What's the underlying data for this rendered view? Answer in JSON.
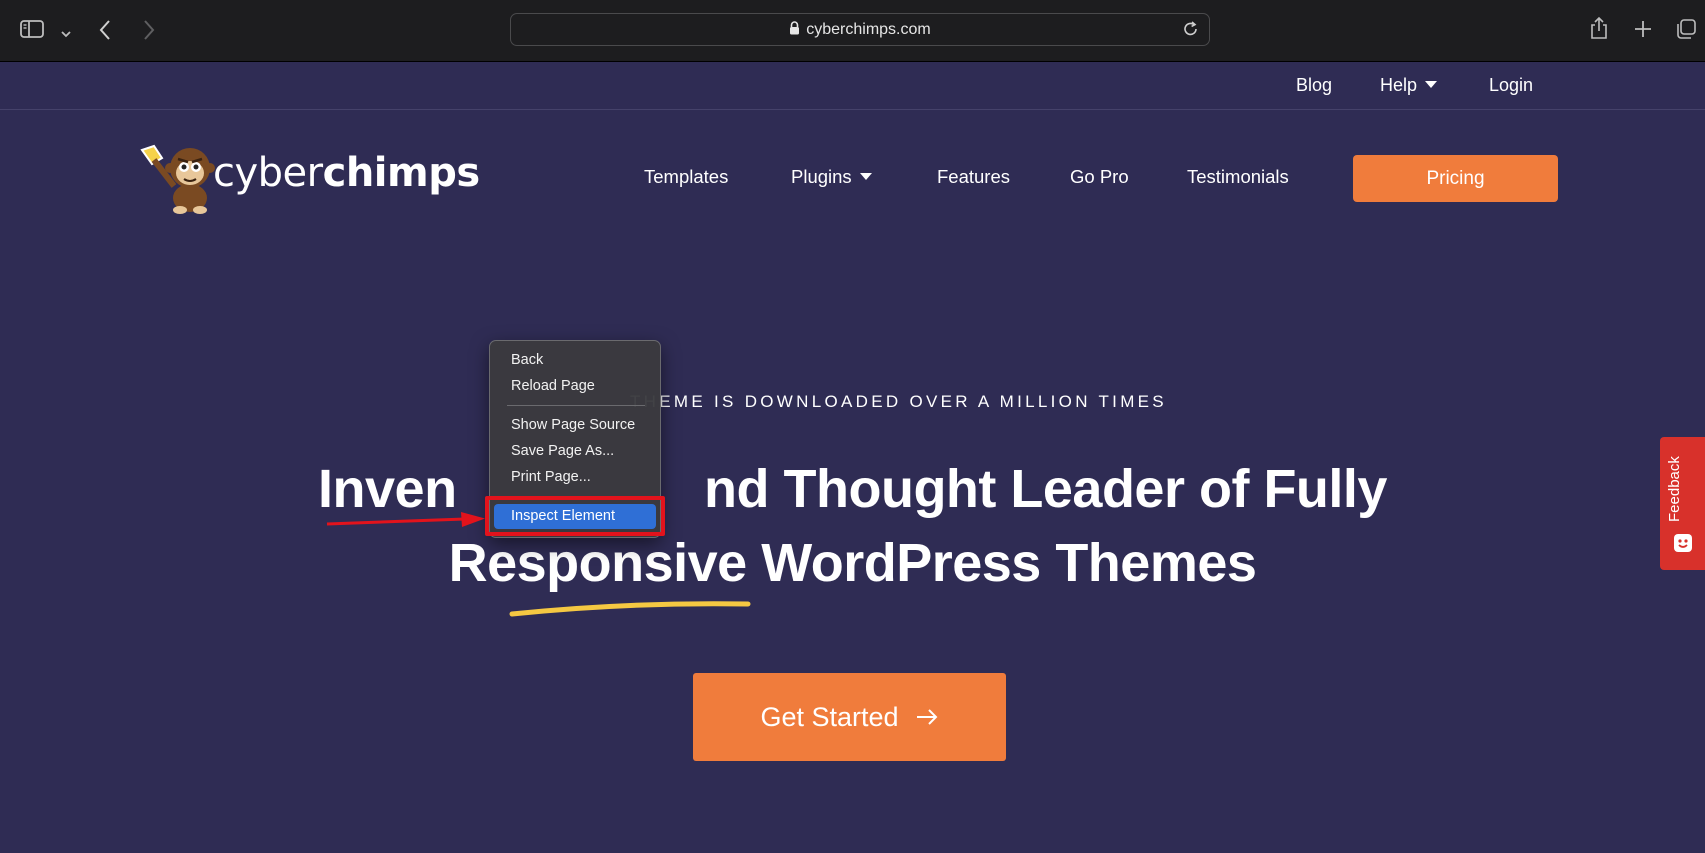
{
  "browser": {
    "url": "cyberchimps.com",
    "icons": [
      "sidebar-icon",
      "chevron-down-icon",
      "back-arrow-icon",
      "forward-arrow-icon",
      "lock-icon",
      "reload-icon",
      "share-icon",
      "new-tab-icon",
      "tabs-overview-icon"
    ]
  },
  "topnav": {
    "blog": "Blog",
    "help": "Help",
    "login": "Login"
  },
  "header": {
    "logo_text_regular": "cyber",
    "logo_text_bold": "chimps",
    "nav": {
      "templates": "Templates",
      "plugins": "Plugins",
      "features": "Features",
      "go_pro": "Go Pro",
      "testimonials": "Testimonials"
    },
    "pricing": "Pricing"
  },
  "hero": {
    "tagline": "THEME IS DOWNLOADED OVER A MILLION TIMES",
    "headline_line1": "Inven                        nd Thought Leader of Fully",
    "headline_line2": "Responsive WordPress Themes",
    "cta": "Get Started"
  },
  "context_menu": {
    "items": [
      "Back",
      "Reload Page",
      "Show Page Source",
      "Save Page As...",
      "Print Page...",
      "Inspect Element"
    ],
    "selected": "Inspect Element"
  },
  "feedback": {
    "label": "Feedback"
  },
  "colors": {
    "page_bg": "#2f2c54",
    "accent": "#f07c3c",
    "highlight": "#e2131c",
    "menu_selected": "#2f6fd6",
    "feedback_bg": "#d8312b"
  }
}
